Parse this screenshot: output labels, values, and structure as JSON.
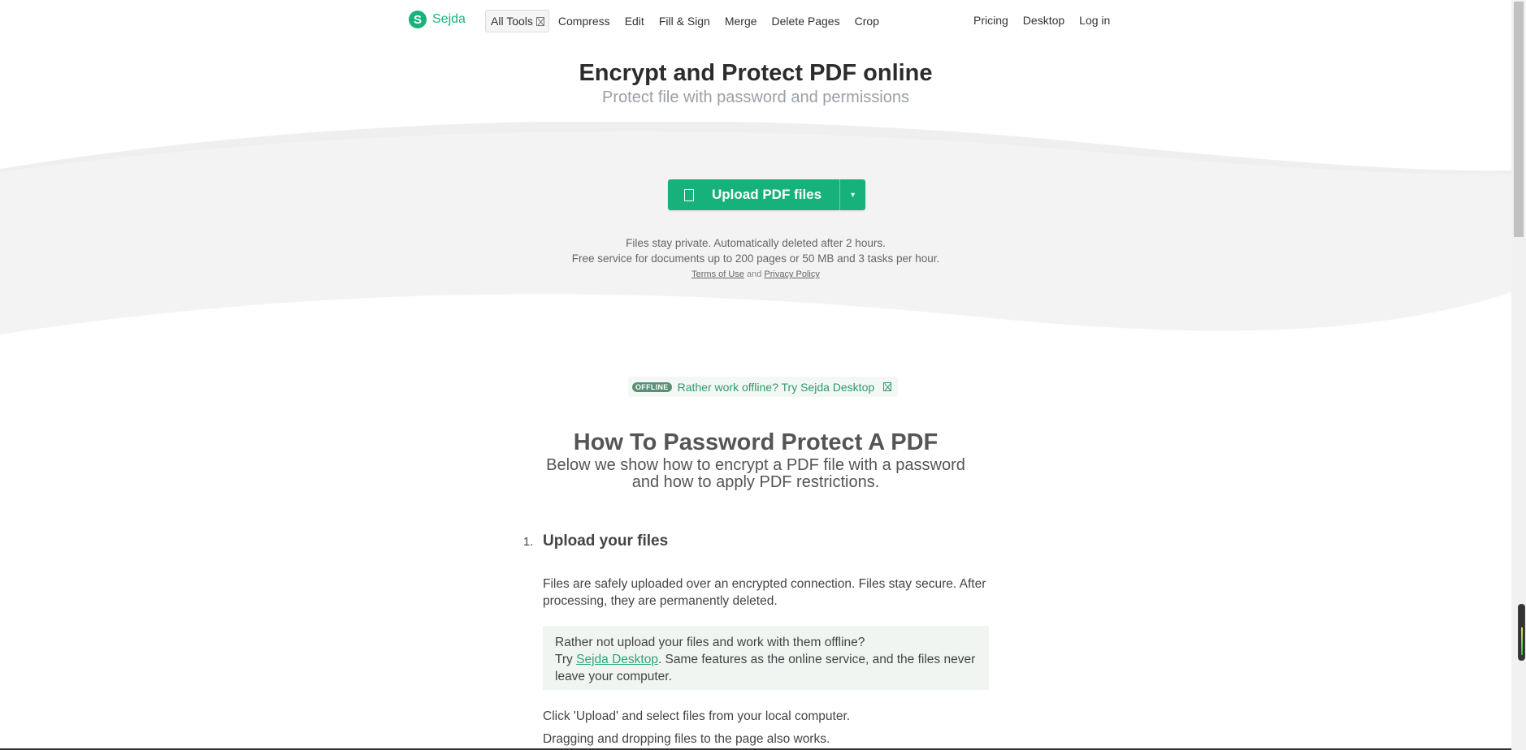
{
  "brand": {
    "name": "Sejda",
    "mark": "S"
  },
  "nav": {
    "left": [
      {
        "label": "All Tools",
        "boxed": true
      },
      {
        "label": "Compress"
      },
      {
        "label": "Edit"
      },
      {
        "label": "Fill & Sign"
      },
      {
        "label": "Merge"
      },
      {
        "label": "Delete Pages"
      },
      {
        "label": "Crop"
      }
    ],
    "right": [
      {
        "label": "Pricing"
      },
      {
        "label": "Desktop"
      },
      {
        "label": "Log in"
      }
    ]
  },
  "hero": {
    "title": "Encrypt and Protect PDF online",
    "subtitle": "Protect file with password and permissions"
  },
  "upload": {
    "label": "Upload PDF files",
    "caret": "▾"
  },
  "privacy": {
    "line1": "Files stay private. Automatically deleted after 2 hours.",
    "line2": "Free service for documents up to 200 pages or 50 MB and 3 tasks per hour.",
    "terms": "Terms of Use",
    "and": "and",
    "policy": "Privacy Policy"
  },
  "offline": {
    "badge": "OFFLINE",
    "text": "Rather work offline? Try Sejda Desktop"
  },
  "howto": {
    "title": "How To Password Protect A PDF",
    "subtitle_line1": "Below we show how to encrypt a PDF file with a password",
    "subtitle_line2": "and how to apply PDF restrictions.",
    "step_number": "1.",
    "step_title": "Upload your files",
    "para1": "Files are safely uploaded over an encrypted connection. Files stay secure. After processing, they are permanently deleted.",
    "callout_line1": "Rather not upload your files and work with them offline?",
    "callout_try": "Try",
    "callout_link": "Sejda Desktop",
    "callout_rest": ". Same features as the online service, and the files never leave your computer.",
    "para2": "Click 'Upload' and select files from your local computer.",
    "para3": "Dragging and dropping files to the page also works."
  },
  "colors": {
    "accent": "#17b27b",
    "band": "#f3f3f3"
  }
}
